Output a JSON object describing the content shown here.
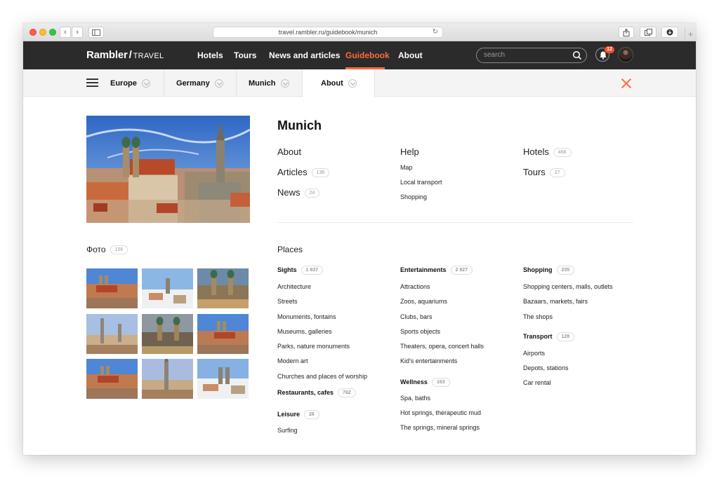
{
  "browser": {
    "url": "travel.rambler.ru/guidebook/munich"
  },
  "header": {
    "logo_brand": "Rambler",
    "logo_slash": "/",
    "logo_sub": "TRAVEL",
    "nav": [
      "Hotels",
      "Tours",
      "News and articles",
      "Guidebook",
      "About"
    ],
    "active_nav": "Guidebook",
    "search_placeholder": "search",
    "notifications_count": "12",
    "accent_color": "#ff6a3d",
    "bg_color": "#2b2b2b"
  },
  "breadcrumbs": [
    "Europe",
    "Germany",
    "Munich",
    "About"
  ],
  "city": {
    "title": "Munich",
    "links_col1": [
      {
        "label": "About",
        "count": ""
      },
      {
        "label": "Articles",
        "count": "136"
      },
      {
        "label": "News",
        "count": "24"
      }
    ],
    "help": {
      "title": "Help",
      "items": [
        "Map",
        "Local transport",
        "Shopping"
      ]
    },
    "links_col3": [
      {
        "label": "Hotels",
        "count": "466"
      },
      {
        "label": "Tours",
        "count": "27"
      }
    ]
  },
  "photos": {
    "title": "Фото",
    "count": "156"
  },
  "places": {
    "title": "Places",
    "sights": {
      "label": "Sights",
      "count": "1 837",
      "items": [
        "Architecture",
        "Streets",
        "Monuments, fontains",
        "Museums, galleries",
        "Parks, nature monuments",
        "Modern art",
        "Churches and places of worship"
      ]
    },
    "restaurants": {
      "label": "Restaurants, cafes",
      "count": "762"
    },
    "leisure": {
      "label": "Leisure",
      "count": "26",
      "items": [
        "Surfing"
      ]
    },
    "entertainments": {
      "label": "Entertainments",
      "count": "2 827",
      "items": [
        "Attractions",
        "Zoos, aquariums",
        "Clubs, bars",
        "Sports objects",
        "Theaters, opera, concert halls",
        "Kid's entertainments"
      ]
    },
    "wellness": {
      "label": "Wellness",
      "count": "163",
      "items": [
        "Spa, baths",
        "Hot springs, therapeutic mud",
        "The springs, mineral springs"
      ]
    },
    "shopping": {
      "label": "Shopping",
      "count": "235",
      "items": [
        "Shopping centers, malls, outlets",
        "Bazaars, markets, fairs",
        "The shops"
      ]
    },
    "transport": {
      "label": "Transport",
      "count": "128",
      "items": [
        "Airports",
        "Depots, stations",
        "Car rental"
      ]
    }
  }
}
